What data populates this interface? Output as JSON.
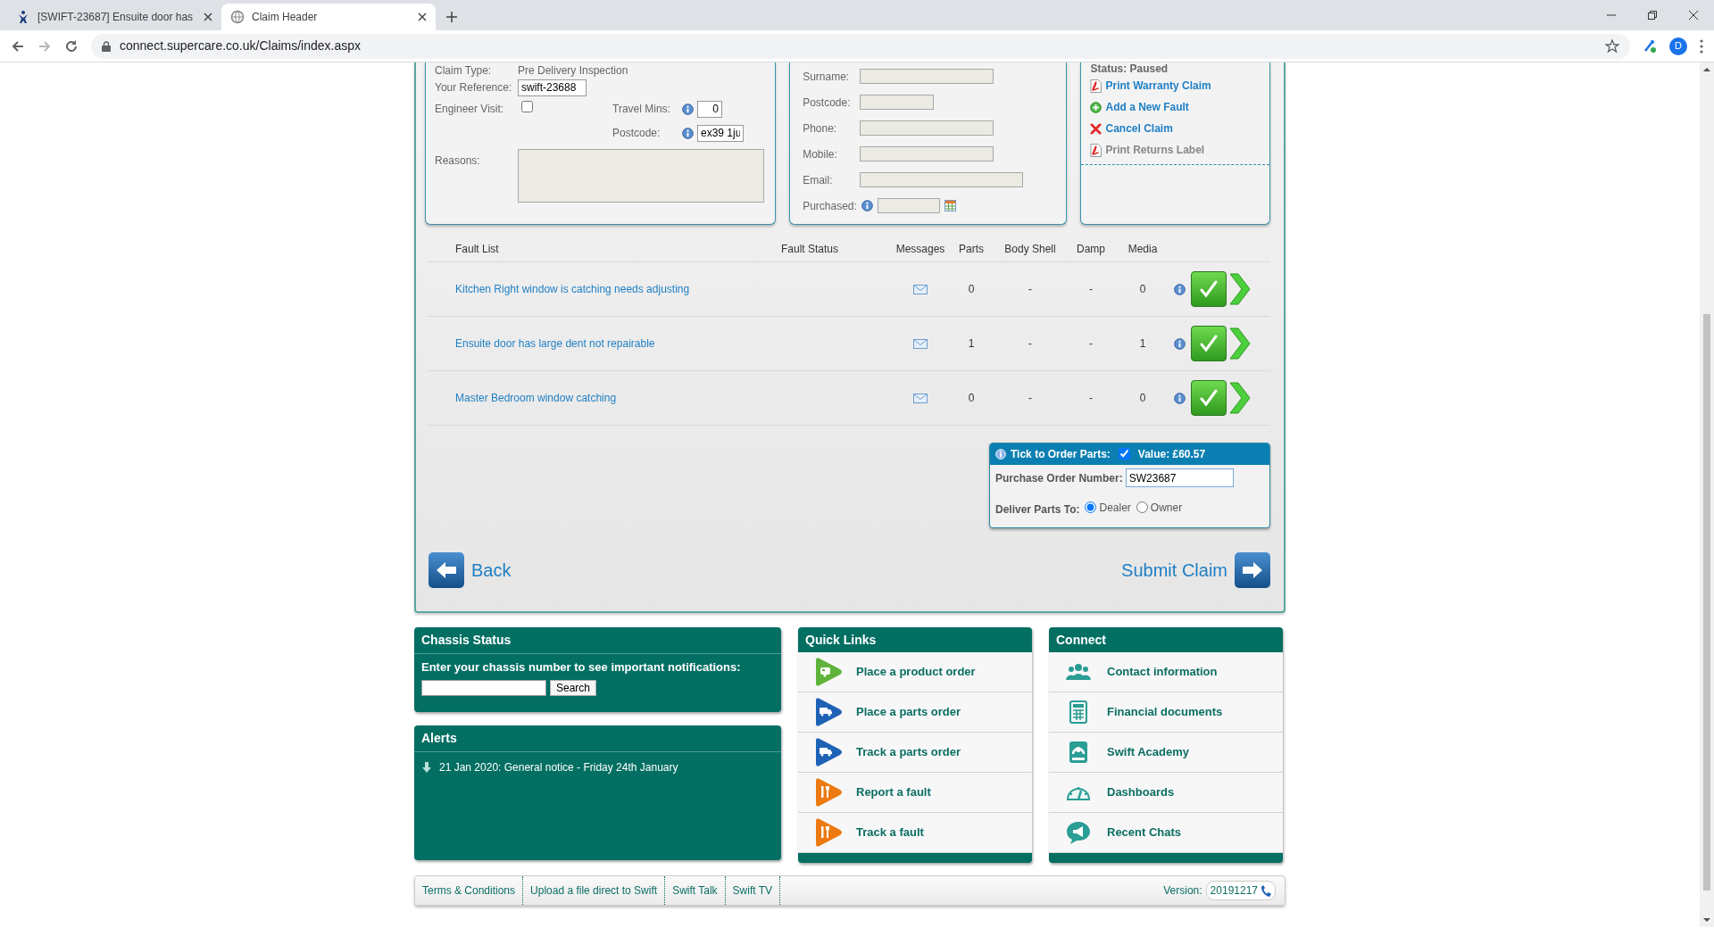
{
  "browser": {
    "tabs": [
      {
        "title": "[SWIFT-23687] Ensuite door has",
        "selected": false
      },
      {
        "title": "Claim Header",
        "selected": true
      }
    ],
    "url": "connect.supercare.co.uk/Claims/index.aspx",
    "avatar": "D"
  },
  "claim": {
    "claim_type": {
      "label": "Claim Type:",
      "value": "Pre Delivery Inspection"
    },
    "reference": {
      "label": "Your Reference:",
      "value": "swift-23688"
    },
    "engineer_visit": {
      "label": "Engineer Visit:",
      "checked": false
    },
    "travel_mins": {
      "label": "Travel Mins:",
      "value": "0"
    },
    "postcode": {
      "label": "Postcode:",
      "value": "ex39 1ju"
    },
    "reasons": {
      "label": "Reasons:"
    }
  },
  "customer": {
    "fields": [
      {
        "label": "Surname:",
        "kind": "medium"
      },
      {
        "label": "Postcode:",
        "kind": "short"
      },
      {
        "label": "Phone:",
        "kind": "medium"
      },
      {
        "label": "Mobile:",
        "kind": "medium"
      },
      {
        "label": "Email:",
        "kind": "long"
      },
      {
        "label": "Purchased:",
        "kind": "date"
      }
    ]
  },
  "actions": {
    "status": "Status: Paused",
    "items": [
      {
        "label": "Print Warranty Claim",
        "kind": "pdf",
        "disabled": false
      },
      {
        "label": "Add a New Fault",
        "kind": "add",
        "disabled": false
      },
      {
        "label": "Cancel Claim",
        "kind": "cancel",
        "disabled": false
      },
      {
        "label": "Print Returns Label",
        "kind": "pdf",
        "disabled": true
      }
    ]
  },
  "faults": {
    "columns": [
      "Fault List",
      "Fault Status",
      "Messages",
      "Parts",
      "Body Shell",
      "Damp",
      "Media"
    ],
    "rows": [
      {
        "fault": "Kitchen Right window is catching needs adjusting",
        "parts": "0",
        "body_shell": "-",
        "damp": "-",
        "media": "0"
      },
      {
        "fault": "Ensuite door has large dent not repairable",
        "parts": "1",
        "body_shell": "-",
        "damp": "-",
        "media": "1"
      },
      {
        "fault": "Master Bedroom window catching",
        "parts": "0",
        "body_shell": "-",
        "damp": "-",
        "media": "0"
      }
    ]
  },
  "order_parts": {
    "title": "Tick to Order Parts:",
    "checked": true,
    "value": "Value: £60.57",
    "po_label": "Purchase Order Number:",
    "po_value": "SW23687",
    "deliver_label": "Deliver Parts To:",
    "options": [
      {
        "label": "Dealer",
        "selected": true
      },
      {
        "label": "Owner",
        "selected": false
      }
    ]
  },
  "nav": {
    "back": "Back",
    "submit": "Submit Claim"
  },
  "chassis": {
    "title": "Chassis Status",
    "prompt": "Enter your chassis number to see important notifications:",
    "button": "Search"
  },
  "alerts": {
    "title": "Alerts",
    "items": [
      "21 Jan 2020: General notice - Friday 24th January"
    ]
  },
  "quick_links": {
    "title": "Quick Links",
    "items": [
      {
        "label": "Place a product order",
        "kind": "product"
      },
      {
        "label": "Place a parts order",
        "kind": "parts"
      },
      {
        "label": "Track a parts order",
        "kind": "parts"
      },
      {
        "label": "Report a fault",
        "kind": "fault"
      },
      {
        "label": "Track a fault",
        "kind": "fault"
      }
    ]
  },
  "connect": {
    "title": "Connect",
    "items": [
      {
        "label": "Contact information",
        "kind": "contacts"
      },
      {
        "label": "Financial documents",
        "kind": "calculator"
      },
      {
        "label": "Swift Academy",
        "kind": "academy"
      },
      {
        "label": "Dashboards",
        "kind": "dashboard"
      },
      {
        "label": "Recent Chats",
        "kind": "chat"
      }
    ]
  },
  "footer": {
    "links": [
      "Terms & Conditions",
      "Upload a file direct to Swift",
      "Swift Talk",
      "Swift TV"
    ],
    "version_label": "Version:",
    "version": "20191217"
  }
}
